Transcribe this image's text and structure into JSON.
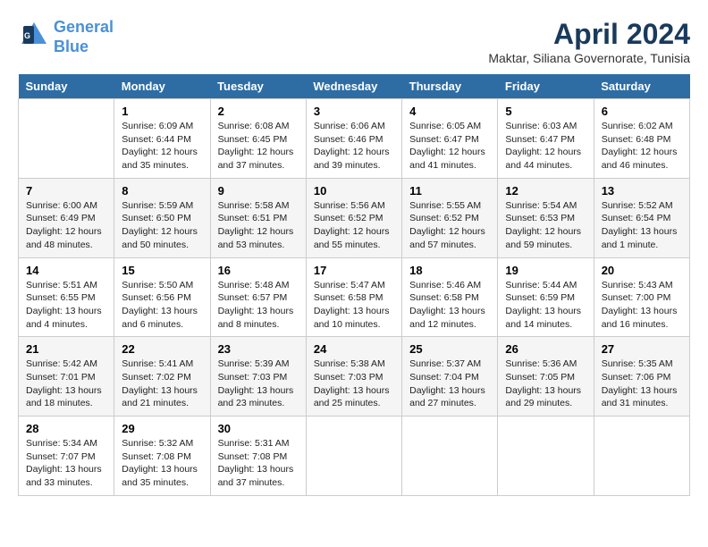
{
  "header": {
    "logo_line1": "General",
    "logo_line2": "Blue",
    "title": "April 2024",
    "subtitle": "Maktar, Siliana Governorate, Tunisia"
  },
  "days_of_week": [
    "Sunday",
    "Monday",
    "Tuesday",
    "Wednesday",
    "Thursday",
    "Friday",
    "Saturday"
  ],
  "weeks": [
    [
      {
        "day": "",
        "info": ""
      },
      {
        "day": "1",
        "info": "Sunrise: 6:09 AM\nSunset: 6:44 PM\nDaylight: 12 hours\nand 35 minutes."
      },
      {
        "day": "2",
        "info": "Sunrise: 6:08 AM\nSunset: 6:45 PM\nDaylight: 12 hours\nand 37 minutes."
      },
      {
        "day": "3",
        "info": "Sunrise: 6:06 AM\nSunset: 6:46 PM\nDaylight: 12 hours\nand 39 minutes."
      },
      {
        "day": "4",
        "info": "Sunrise: 6:05 AM\nSunset: 6:47 PM\nDaylight: 12 hours\nand 41 minutes."
      },
      {
        "day": "5",
        "info": "Sunrise: 6:03 AM\nSunset: 6:47 PM\nDaylight: 12 hours\nand 44 minutes."
      },
      {
        "day": "6",
        "info": "Sunrise: 6:02 AM\nSunset: 6:48 PM\nDaylight: 12 hours\nand 46 minutes."
      }
    ],
    [
      {
        "day": "7",
        "info": "Sunrise: 6:00 AM\nSunset: 6:49 PM\nDaylight: 12 hours\nand 48 minutes."
      },
      {
        "day": "8",
        "info": "Sunrise: 5:59 AM\nSunset: 6:50 PM\nDaylight: 12 hours\nand 50 minutes."
      },
      {
        "day": "9",
        "info": "Sunrise: 5:58 AM\nSunset: 6:51 PM\nDaylight: 12 hours\nand 53 minutes."
      },
      {
        "day": "10",
        "info": "Sunrise: 5:56 AM\nSunset: 6:52 PM\nDaylight: 12 hours\nand 55 minutes."
      },
      {
        "day": "11",
        "info": "Sunrise: 5:55 AM\nSunset: 6:52 PM\nDaylight: 12 hours\nand 57 minutes."
      },
      {
        "day": "12",
        "info": "Sunrise: 5:54 AM\nSunset: 6:53 PM\nDaylight: 12 hours\nand 59 minutes."
      },
      {
        "day": "13",
        "info": "Sunrise: 5:52 AM\nSunset: 6:54 PM\nDaylight: 13 hours\nand 1 minute."
      }
    ],
    [
      {
        "day": "14",
        "info": "Sunrise: 5:51 AM\nSunset: 6:55 PM\nDaylight: 13 hours\nand 4 minutes."
      },
      {
        "day": "15",
        "info": "Sunrise: 5:50 AM\nSunset: 6:56 PM\nDaylight: 13 hours\nand 6 minutes."
      },
      {
        "day": "16",
        "info": "Sunrise: 5:48 AM\nSunset: 6:57 PM\nDaylight: 13 hours\nand 8 minutes."
      },
      {
        "day": "17",
        "info": "Sunrise: 5:47 AM\nSunset: 6:58 PM\nDaylight: 13 hours\nand 10 minutes."
      },
      {
        "day": "18",
        "info": "Sunrise: 5:46 AM\nSunset: 6:58 PM\nDaylight: 13 hours\nand 12 minutes."
      },
      {
        "day": "19",
        "info": "Sunrise: 5:44 AM\nSunset: 6:59 PM\nDaylight: 13 hours\nand 14 minutes."
      },
      {
        "day": "20",
        "info": "Sunrise: 5:43 AM\nSunset: 7:00 PM\nDaylight: 13 hours\nand 16 minutes."
      }
    ],
    [
      {
        "day": "21",
        "info": "Sunrise: 5:42 AM\nSunset: 7:01 PM\nDaylight: 13 hours\nand 18 minutes."
      },
      {
        "day": "22",
        "info": "Sunrise: 5:41 AM\nSunset: 7:02 PM\nDaylight: 13 hours\nand 21 minutes."
      },
      {
        "day": "23",
        "info": "Sunrise: 5:39 AM\nSunset: 7:03 PM\nDaylight: 13 hours\nand 23 minutes."
      },
      {
        "day": "24",
        "info": "Sunrise: 5:38 AM\nSunset: 7:03 PM\nDaylight: 13 hours\nand 25 minutes."
      },
      {
        "day": "25",
        "info": "Sunrise: 5:37 AM\nSunset: 7:04 PM\nDaylight: 13 hours\nand 27 minutes."
      },
      {
        "day": "26",
        "info": "Sunrise: 5:36 AM\nSunset: 7:05 PM\nDaylight: 13 hours\nand 29 minutes."
      },
      {
        "day": "27",
        "info": "Sunrise: 5:35 AM\nSunset: 7:06 PM\nDaylight: 13 hours\nand 31 minutes."
      }
    ],
    [
      {
        "day": "28",
        "info": "Sunrise: 5:34 AM\nSunset: 7:07 PM\nDaylight: 13 hours\nand 33 minutes."
      },
      {
        "day": "29",
        "info": "Sunrise: 5:32 AM\nSunset: 7:08 PM\nDaylight: 13 hours\nand 35 minutes."
      },
      {
        "day": "30",
        "info": "Sunrise: 5:31 AM\nSunset: 7:08 PM\nDaylight: 13 hours\nand 37 minutes."
      },
      {
        "day": "",
        "info": ""
      },
      {
        "day": "",
        "info": ""
      },
      {
        "day": "",
        "info": ""
      },
      {
        "day": "",
        "info": ""
      }
    ]
  ]
}
